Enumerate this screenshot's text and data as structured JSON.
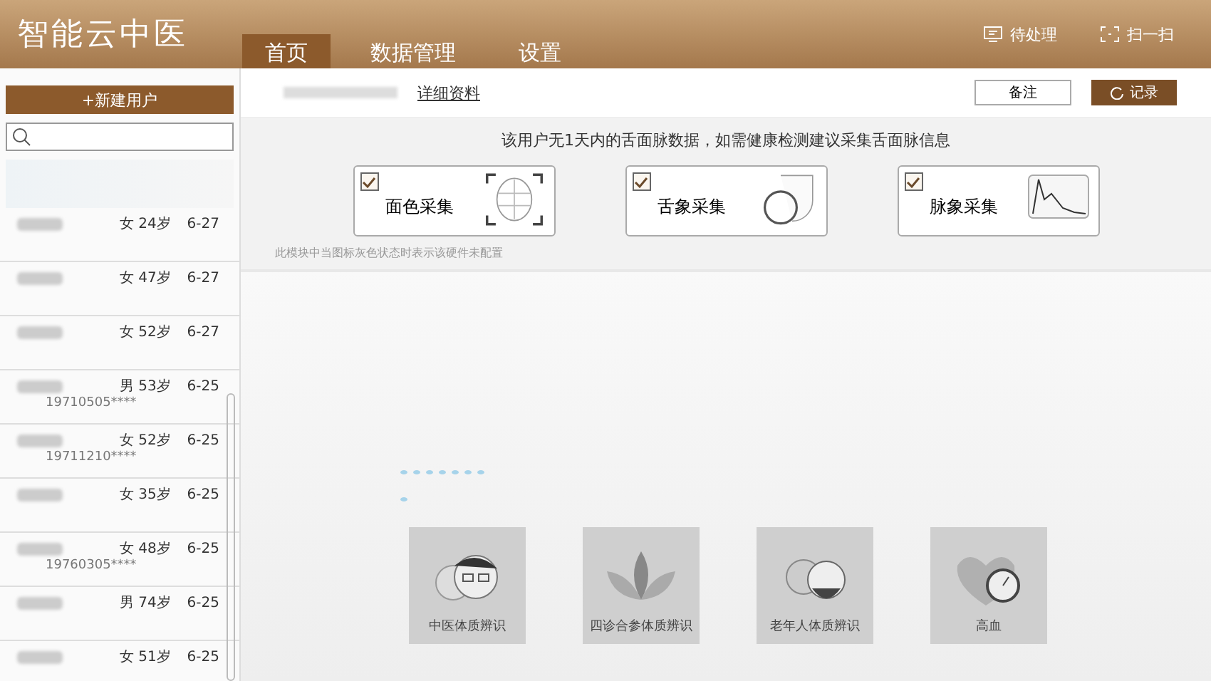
{
  "app_title": "智能云中医",
  "nav_tabs": [
    {
      "label": "首页",
      "selected": true
    },
    {
      "label": "数据管理",
      "selected": false
    },
    {
      "label": "设置",
      "selected": false
    }
  ],
  "header_actions": [
    {
      "kind": "pending",
      "label": "待处理"
    },
    {
      "kind": "scan",
      "label": "扫一扫"
    }
  ],
  "new_user_button": "+新建用户",
  "patients": [
    {
      "info": "女 24岁",
      "date": "6-27"
    },
    {
      "info": "女 47岁",
      "date": "6-27"
    },
    {
      "info": "女 52岁",
      "date": "6-27"
    },
    {
      "info": "男 53岁",
      "date": "6-25",
      "id": "19710505****"
    },
    {
      "info": "女 52岁",
      "date": "6-25",
      "id": "19711210****"
    },
    {
      "info": "女 35岁",
      "date": "6-25"
    },
    {
      "info": "女 48岁",
      "date": "6-25",
      "id": "19760305****"
    },
    {
      "info": "男 74岁",
      "date": "6-25"
    },
    {
      "info": "女 51岁",
      "date": "6-25"
    }
  ],
  "detail_link": "详细资料",
  "note_button": "备注",
  "record_button": "记录",
  "notice": "该用户无1天内的舌面脉数据，如需健康检测建议采集舌面脉信息",
  "collectors": [
    {
      "kind": "face",
      "label": "面色采集",
      "checked": true
    },
    {
      "kind": "tongue",
      "label": "舌象采集",
      "checked": true
    },
    {
      "kind": "pulse",
      "label": "脉象采集",
      "checked": true
    }
  ],
  "hint": "此模块中当图标灰色状态时表示该硬件未配置",
  "modules": [
    {
      "kind": "constitution",
      "label": "中医体质辨识"
    },
    {
      "kind": "lotus",
      "label": "四诊合参体质辨识"
    },
    {
      "kind": "elderly",
      "label": "老年人体质辨识"
    },
    {
      "kind": "bp",
      "label": "高血"
    }
  ]
}
